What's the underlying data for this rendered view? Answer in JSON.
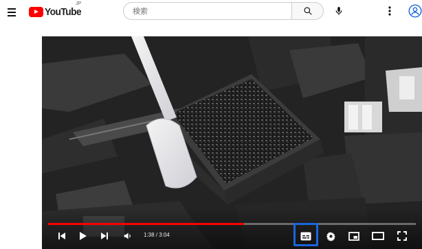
{
  "header": {
    "logo_text": "YouTube",
    "region": "JP",
    "search": {
      "placeholder": "検索"
    },
    "icons": [
      "menu-icon",
      "search-icon",
      "mic-icon",
      "more-vert-icon",
      "account-icon"
    ],
    "brand_red": "#ff0000"
  },
  "player": {
    "time_current": "1:38",
    "time_total": "3:04",
    "progress_fraction": 0.533,
    "progress_color": "#ff0000",
    "highlight_color": "#1a66e0",
    "highlighted_control": "subtitles-button",
    "controls": [
      "previous-icon",
      "play-icon",
      "next-icon",
      "volume-icon",
      "subtitles-icon",
      "settings-icon",
      "miniplayer-icon",
      "theater-icon",
      "fullscreen-icon"
    ]
  }
}
